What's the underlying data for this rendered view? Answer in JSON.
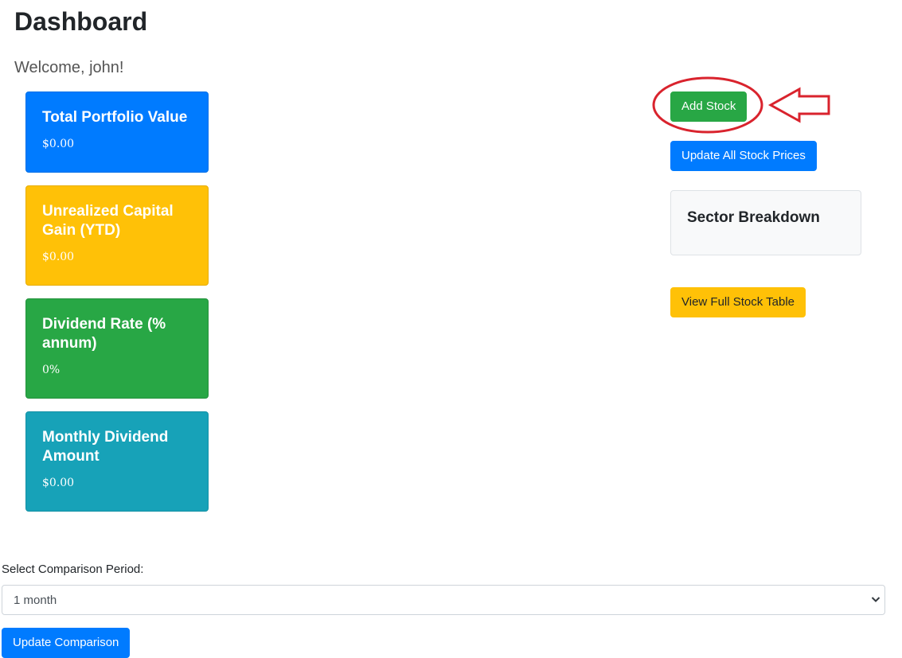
{
  "header": {
    "title": "Dashboard",
    "welcome": "Welcome, john!"
  },
  "cards": [
    {
      "title": "Total Portfolio Value",
      "value": "$0.00",
      "color": "#007bff"
    },
    {
      "title": "Unrealized Capital Gain (YTD)",
      "value": "$0.00",
      "color": "#ffc107"
    },
    {
      "title": "Dividend Rate (% annum)",
      "value": "0%",
      "color": "#28a745"
    },
    {
      "title": "Monthly Dividend Amount",
      "value": "$0.00",
      "color": "#17a2b8"
    }
  ],
  "actions": {
    "add_stock": "Add Stock",
    "update_prices": "Update All Stock Prices",
    "view_table": "View Full Stock Table"
  },
  "sector": {
    "title": "Sector Breakdown"
  },
  "comparison": {
    "label": "Select Comparison Period:",
    "selected": "1 month",
    "button": "Update Comparison"
  },
  "annotation": {
    "color": "#d9232d",
    "shapes": [
      "ellipse",
      "arrow-left-icon"
    ]
  }
}
